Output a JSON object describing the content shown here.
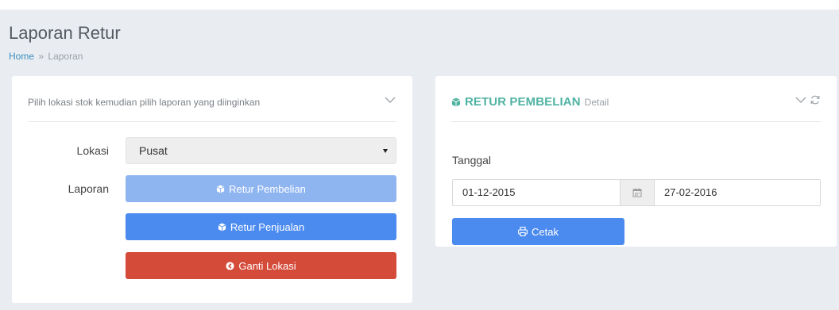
{
  "header": {
    "title": "Laporan Retur",
    "breadcrumb": {
      "home": "Home",
      "separator": "»",
      "current": "Laporan"
    }
  },
  "left_panel": {
    "subtitle": "Pilih lokasi stok kemudian pilih laporan yang diinginkan",
    "lokasi_label": "Lokasi",
    "lokasi_value": "Pusat",
    "laporan_label": "Laporan",
    "buttons": {
      "retur_pembelian": "Retur Pembelian",
      "retur_penjualan": "Retur Penjualan",
      "ganti_lokasi": "Ganti Lokasi"
    }
  },
  "right_panel": {
    "title": "RETUR PEMBELIAN",
    "subtitle": "Detail",
    "tanggal_label": "Tanggal",
    "date_from": "01-12-2015",
    "date_to": "27-02-2016",
    "cetak_label": "Cetak"
  },
  "colors": {
    "primary": "#4b8bef",
    "primary_light": "#8fb5f0",
    "danger": "#d54b3a",
    "title_teal": "#4fb3a2",
    "link": "#3c8dbc",
    "content_bg": "#e9edf2"
  },
  "icons": [
    "cube-icon",
    "arrow-circle-left-icon",
    "print-icon",
    "calendar-icon",
    "chevron-down-icon",
    "refresh-icon"
  ]
}
